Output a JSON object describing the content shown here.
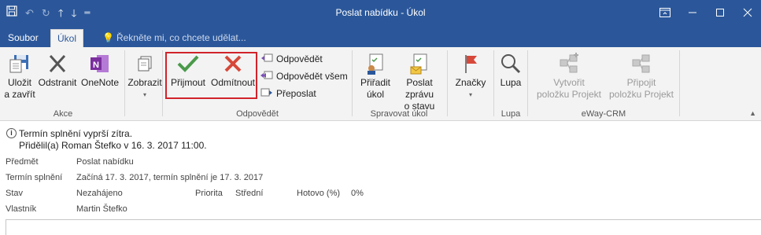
{
  "window": {
    "title": "Poslat nabídku - Úkol"
  },
  "quick_access": {
    "icons": [
      "save-icon",
      "undo-icon",
      "redo-icon",
      "arrow-up-icon",
      "arrow-down-icon",
      "customize-icon"
    ]
  },
  "tabs": {
    "file": "Soubor",
    "task": "Úkol"
  },
  "tell_me": {
    "placeholder": "Řekněte mi, co chcete udělat..."
  },
  "ribbon": {
    "actions": {
      "label": "Akce",
      "save_close": [
        "Uložit",
        "a zavřít"
      ],
      "delete": "Odstranit",
      "onenote": "OneNote"
    },
    "view": {
      "show": "Zobrazit"
    },
    "respond": {
      "label": "Odpovědět",
      "accept": "Přijmout",
      "decline": "Odmítnout",
      "reply": "Odpovědět",
      "reply_all": "Odpovědět všem",
      "forward": "Přeposlat"
    },
    "manage": {
      "label": "Spravovat úkol",
      "assign": [
        "Přiřadit",
        "úkol"
      ],
      "send_status": [
        "Poslat zprávu",
        "o stavu"
      ]
    },
    "tags": {
      "tags": "Značky"
    },
    "zoom": {
      "label": "Lupa",
      "zoom": "Lupa"
    },
    "eway": {
      "label": "eWay-CRM",
      "create_project": [
        "Vytvořit",
        "položku Projekt"
      ],
      "attach_project": [
        "Připojit",
        "položku Projekt"
      ]
    }
  },
  "info": {
    "line1": "Termín splnění vyprší zítra.",
    "line2": "Přidělil(a) Roman Štefko v 16. 3. 2017 11:00."
  },
  "fields": {
    "subject_label": "Předmět",
    "subject_value": "Poslat nabídku",
    "due_label": "Termín splnění",
    "due_value": "Začíná 17. 3. 2017, termín splnění je 17. 3. 2017",
    "status_label": "Stav",
    "status_value": "Nezahájeno",
    "priority_label": "Priorita",
    "priority_value": "Střední",
    "done_label": "Hotovo (%)",
    "done_value": "0%",
    "owner_label": "Vlastník",
    "owner_value": "Martin Štefko"
  },
  "colors": {
    "brand": "#2b579a",
    "accept": "#4a9a4a",
    "decline": "#d6483a",
    "highlight": "#d1232a"
  }
}
